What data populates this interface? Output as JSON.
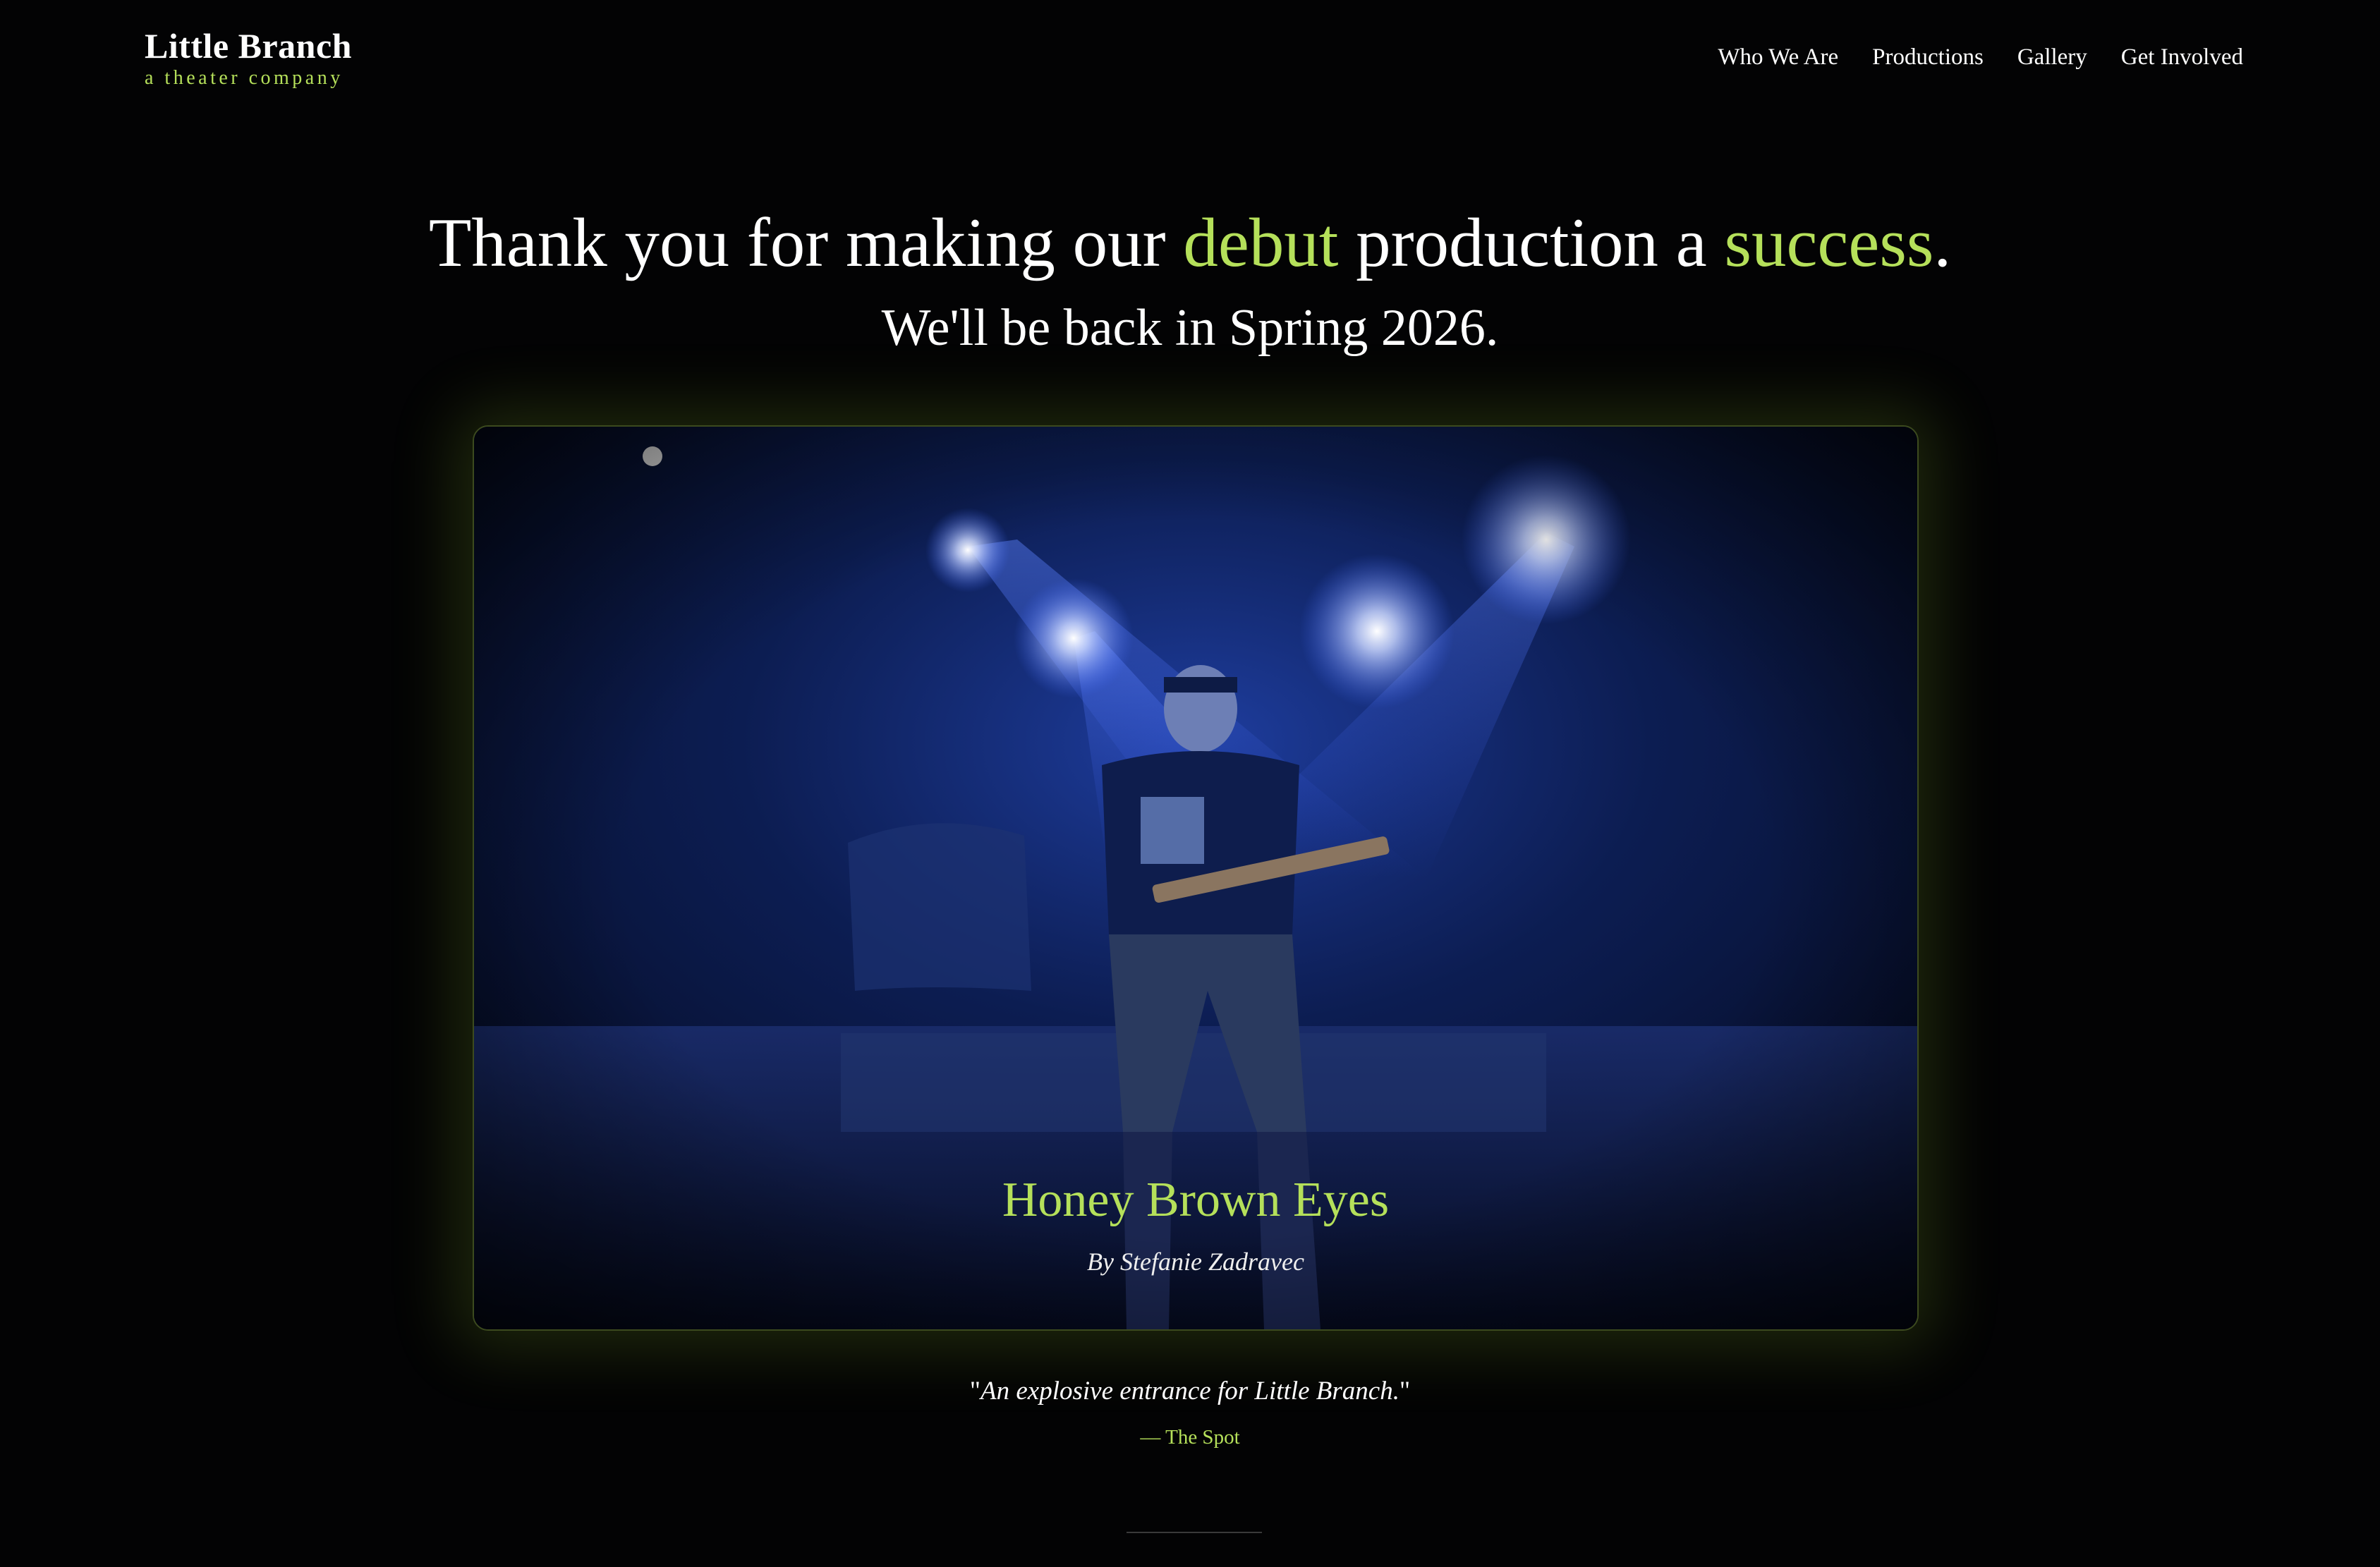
{
  "header": {
    "brand_title": "Little Branch",
    "brand_subtitle": "a theater company",
    "nav": [
      {
        "label": "Who We Are"
      },
      {
        "label": "Productions"
      },
      {
        "label": "Gallery"
      },
      {
        "label": "Get Involved"
      }
    ]
  },
  "hero": {
    "headline_part1": "Thank you for making our ",
    "headline_accent1": "debut",
    "headline_part2": " production a ",
    "headline_accent2": "success",
    "headline_part3": ".",
    "subheadline": "We'll be back in Spring 2026."
  },
  "production": {
    "title": "Honey Brown Eyes",
    "author": "By Stefanie Zadravec",
    "photo_icon": "stage-photo"
  },
  "review": {
    "open_quote": "\"",
    "quote": "An explosive entrance for Little Branch.",
    "close_quote": "\"",
    "source": "— The Spot"
  },
  "colors": {
    "accent": "#b5e05a",
    "background": "#030304",
    "stage_blue": "#2b55d8"
  }
}
